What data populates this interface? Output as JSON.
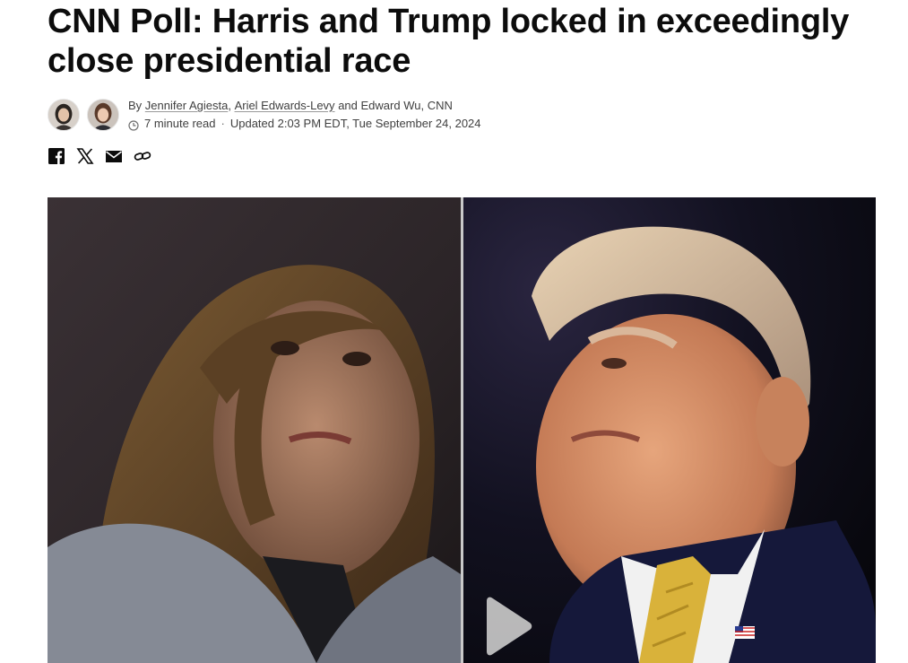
{
  "article": {
    "headline": "CNN Poll: Harris and Trump locked in exceedingly close presidential race",
    "byline": {
      "prefix": "By",
      "authors": [
        "Jennifer Agiesta",
        "Ariel Edwards-Levy"
      ],
      "separator": ",",
      "conjunction": "and",
      "rest": "Edward Wu, CNN"
    },
    "read_time": "7 minute read",
    "dot": "·",
    "updated": "Updated 2:03 PM EDT, Tue September 24, 2024"
  },
  "share": {
    "icons": [
      "facebook-icon",
      "x-icon",
      "email-icon",
      "link-icon"
    ]
  },
  "hero": {
    "type": "video",
    "play_icon": "play-icon"
  },
  "colors": {
    "text": "#0c0c0c",
    "meta": "#404040"
  }
}
